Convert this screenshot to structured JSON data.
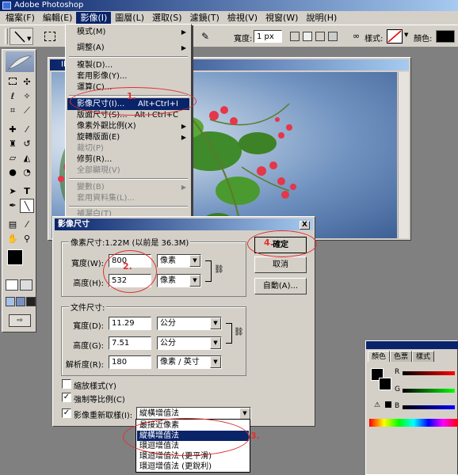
{
  "app": {
    "title": "Adobe Photoshop"
  },
  "menubar": [
    "檔案(F)",
    "編輯(E)",
    "影像(I)",
    "圖層(L)",
    "選取(S)",
    "濾鏡(T)",
    "檢視(V)",
    "視窗(W)",
    "說明(H)"
  ],
  "options": {
    "width_label": "寬度:",
    "width_value": "1 px",
    "style_label": "樣式:",
    "color_label": "顏色:"
  },
  "image_window": {
    "title": "Ib"
  },
  "image_menu": {
    "items": [
      {
        "label": "模式(M)",
        "submenu": true
      },
      {
        "label": "調整(A)",
        "submenu": true
      },
      {
        "label": "複製(D)..."
      },
      {
        "label": "套用影像(Y)..."
      },
      {
        "label": "運算(C)..."
      },
      {
        "label": "影像尺寸(I)...",
        "shortcut": "Alt+Ctrl+I",
        "highlighted": true
      },
      {
        "label": "版面尺寸(S)...",
        "shortcut": "Alt+Ctrl+C"
      },
      {
        "label": "像素外觀比例(X)",
        "submenu": true
      },
      {
        "label": "旋轉版面(E)",
        "submenu": true
      },
      {
        "label": "裁切(P)",
        "disabled": true
      },
      {
        "label": "修剪(R)..."
      },
      {
        "label": "全部顯現(V)",
        "disabled": true
      },
      {
        "label": "變數(B)",
        "submenu": true,
        "disabled": true
      },
      {
        "label": "套用資料集(L)...",
        "disabled": true
      },
      {
        "label": "補漏白(T)",
        "disabled": true
      }
    ]
  },
  "dialog": {
    "title": "影像尺寸",
    "close": "X",
    "pixel_dims": {
      "legend": "像素尺寸:1.22M (以前是 36.3M)",
      "width_label": "寬度(W):",
      "width_value": "800",
      "width_unit": "像素",
      "height_label": "高度(H):",
      "height_value": "532",
      "height_unit": "像素"
    },
    "doc_size": {
      "legend": "文件尺寸:",
      "width_label": "寬度(D):",
      "width_value": "11.29",
      "width_unit": "公分",
      "height_label": "高度(G):",
      "height_value": "7.51",
      "height_unit": "公分",
      "res_label": "解析度(R):",
      "res_value": "180",
      "res_unit": "像素 / 英寸"
    },
    "buttons": {
      "ok": "確定",
      "cancel": "取消",
      "auto": "自動(A)..."
    },
    "checkboxes": [
      {
        "label": "縮放樣式(Y)",
        "checked": false
      },
      {
        "label": "強制等比例(C)",
        "checked": true
      },
      {
        "label": "影像重新取樣(I):",
        "checked": true
      }
    ],
    "resample_value": "縱橫增值法",
    "resample_options": [
      "最接近像素",
      "縱橫增值法",
      "環迴增值法",
      "環迴增值法 (更平滑)",
      "環迴增值法 (更銳利)"
    ],
    "check_mark": "✓"
  },
  "palette": {
    "tabs": [
      "顏色",
      "色票",
      "樣式"
    ],
    "channels": [
      "R",
      "G",
      "B"
    ]
  },
  "annotations": [
    "1.",
    "2.",
    "3.",
    "4."
  ],
  "colors": {
    "annotation": "#e23030",
    "highlight": "#0a246a",
    "chrome": "#d4d0c8"
  }
}
